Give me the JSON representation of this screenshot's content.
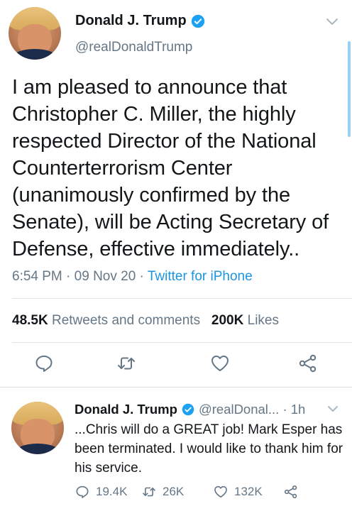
{
  "main_tweet": {
    "display_name": "Donald J. Trump",
    "handle": "@realDonaldTrump",
    "text": "I am pleased to announce that Christopher C. Miller, the highly respected Director of the National Counterterrorism Center (unanimously confirmed by the Senate), will be Acting Secretary of Defense, effective immediately..",
    "time": "6:54 PM",
    "date": "09 Nov 20",
    "separator": " · ",
    "source": "Twitter for iPhone",
    "retweets_count": "48.5K",
    "retweets_label": "Retweets and comments",
    "likes_count": "200K",
    "likes_label": "Likes"
  },
  "reply_tweet": {
    "display_name": "Donald J. Trump",
    "handle": "@realDonal...",
    "time": "· 1h",
    "text": "...Chris will do a GREAT job! Mark Esper has been terminated. I would like to thank him for his service.",
    "reply_count": "19.4K",
    "retweet_count": "26K",
    "like_count": "132K"
  },
  "colors": {
    "accent": "#1b95e0",
    "secondary_text": "#657786",
    "verified": "#1da1f2"
  },
  "icons": [
    "verified-badge-icon",
    "chevron-down-icon",
    "reply-icon",
    "retweet-icon",
    "like-icon",
    "share-icon"
  ]
}
